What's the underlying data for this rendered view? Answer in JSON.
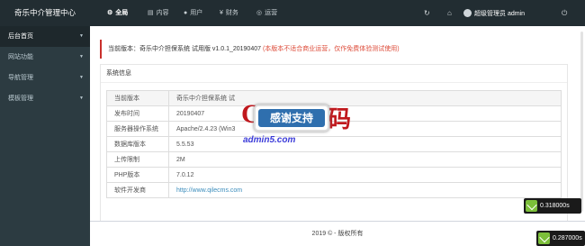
{
  "app": {
    "title": "奇乐中介管理中心"
  },
  "nav": [
    {
      "label": "全局",
      "icon": "gear-icon",
      "active": true
    },
    {
      "label": "内容",
      "icon": "content-icon",
      "active": false
    },
    {
      "label": "用户",
      "icon": "user-icon",
      "active": false
    },
    {
      "label": "财务",
      "icon": "finance-icon",
      "active": false
    },
    {
      "label": "运营",
      "icon": "operation-icon",
      "active": false
    }
  ],
  "topbar": {
    "user_label": "超级管理员 admin"
  },
  "sidebar": {
    "items": [
      {
        "label": "后台首页",
        "active": true
      },
      {
        "label": "网站功能",
        "active": false
      },
      {
        "label": "导航管理",
        "active": false
      },
      {
        "label": "模板管理",
        "active": false
      }
    ]
  },
  "notice": {
    "text": "当前版本：奇乐中介担保系统 试用版 v1.0.1_20190407",
    "warning": "(本版本不适合商业运营，仅作免费体验测试使用)"
  },
  "system": {
    "title": "系统信息",
    "rows": [
      {
        "key": "当前版本",
        "value": "奇乐中介担保系统 试"
      },
      {
        "key": "发布时间",
        "value": "20190407"
      },
      {
        "key": "服务器操作系统",
        "value": "Apache/2.4.23 (Win3"
      },
      {
        "key": "数据库版本",
        "value": "5.5.53"
      },
      {
        "key": "上传限制",
        "value": "2M"
      },
      {
        "key": "PHP版本",
        "value": "7.0.12"
      },
      {
        "key": "软件开发商",
        "value": "http://www.qilecms.com"
      }
    ]
  },
  "watermark": {
    "badge_text": "感谢支持",
    "brand_text": "码",
    "url_text": "admin5.com"
  },
  "footer": {
    "text": "2019 © - 版权所有"
  },
  "timers": {
    "first": "0.318000s",
    "second": "0.287000s"
  },
  "colors": {
    "topbar": "#222d32",
    "sidebar": "#2c3b41",
    "warning": "#dd4b39",
    "link": "#3c8dbc"
  }
}
